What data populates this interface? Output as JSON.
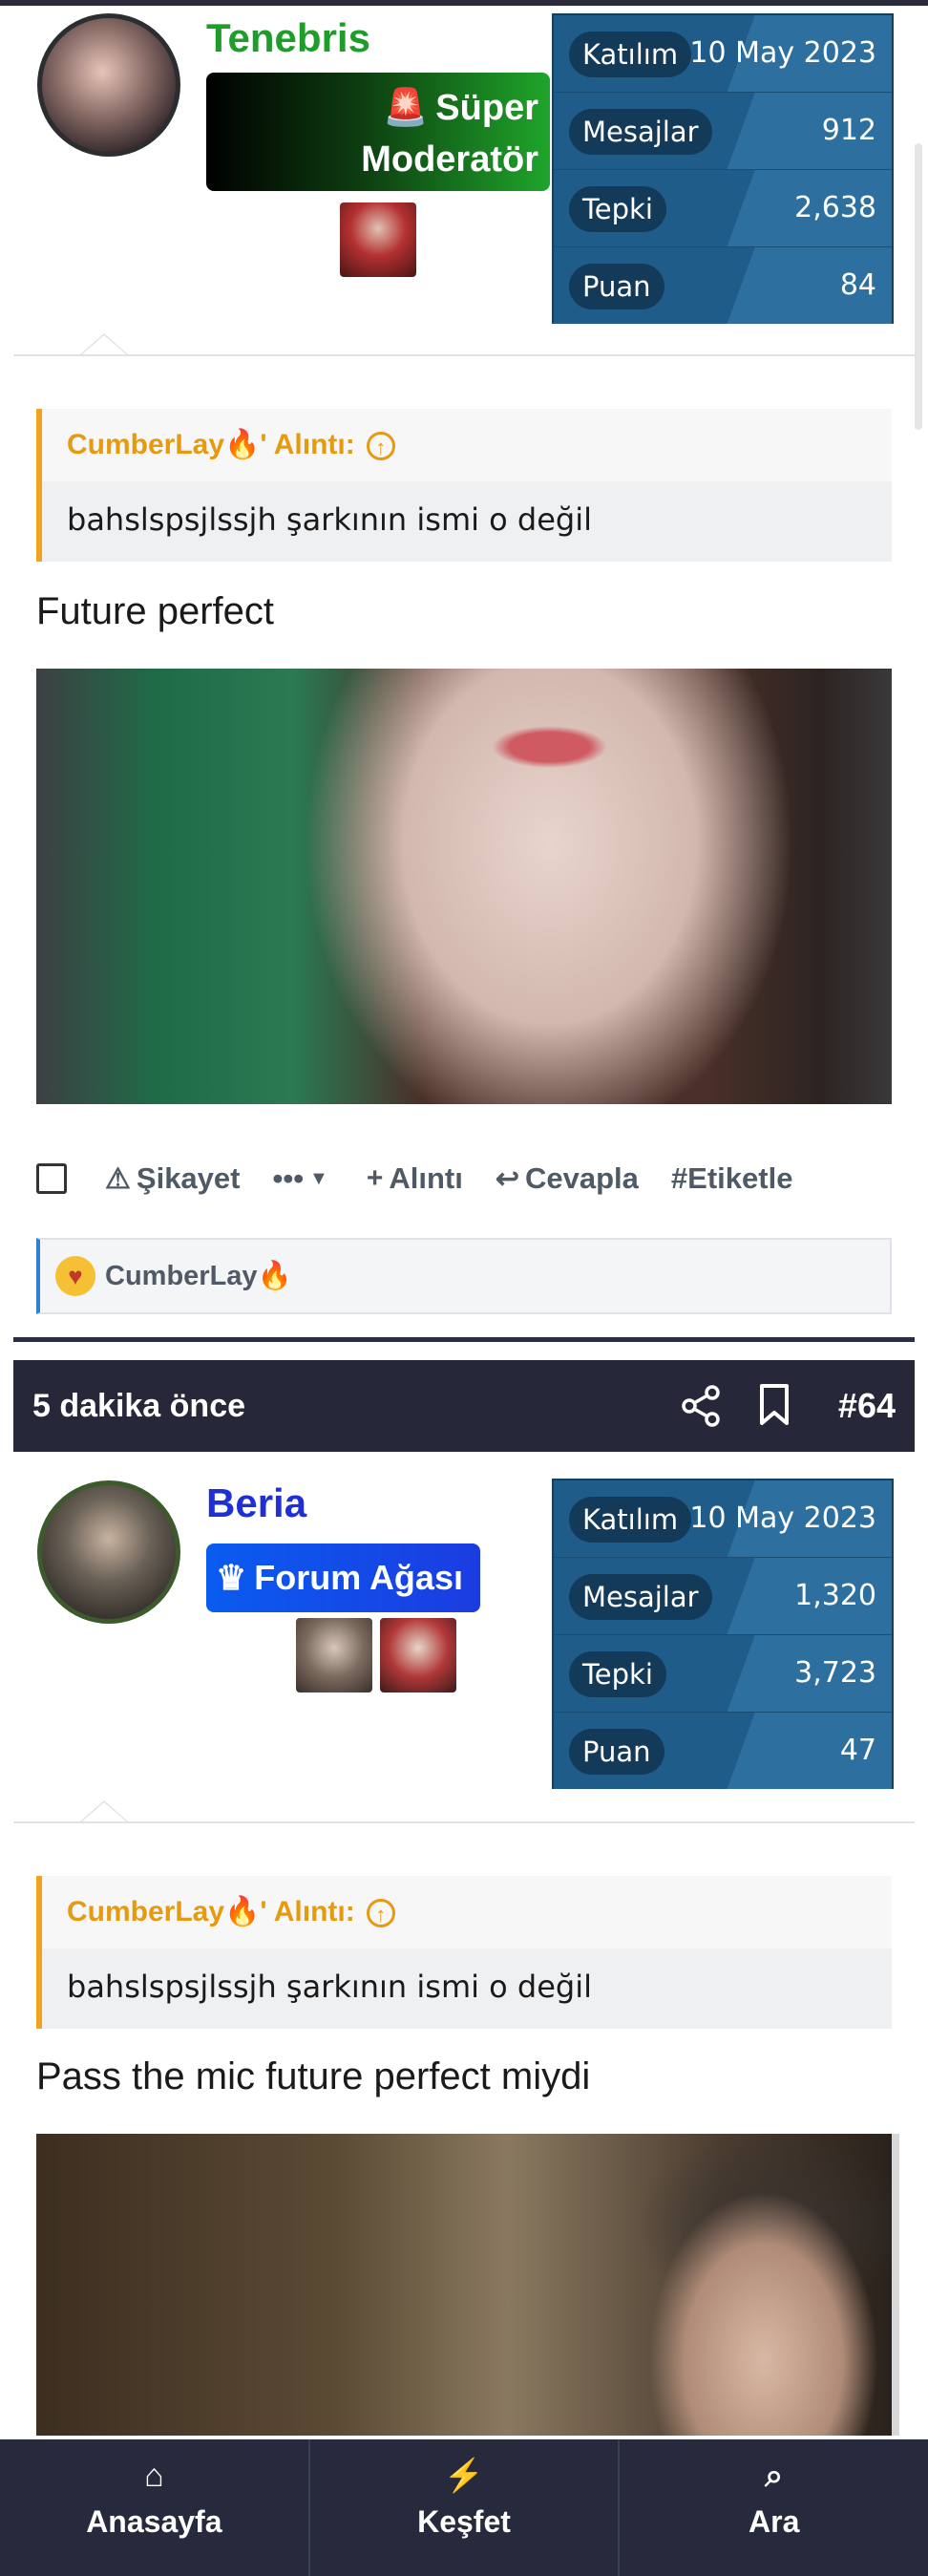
{
  "posts": [
    {
      "username": "Tenebris",
      "role": "Süper Moderatör",
      "stats": [
        {
          "label": "Katılım",
          "value": "10 May 2023"
        },
        {
          "label": "Mesajlar",
          "value": "912"
        },
        {
          "label": "Tepki",
          "value": "2,638"
        },
        {
          "label": "Puan",
          "value": "84"
        }
      ],
      "quote": {
        "author": "CumberLay🔥' Alıntı:",
        "text": "bahslspsjlssjh şarkının ismi o değil"
      },
      "text": "Future perfect",
      "actions": {
        "report": "Şikayet",
        "more": "•••",
        "quote": "Alıntı",
        "reply": "Cevapla",
        "tag": "#Etiketle"
      },
      "reaction_user": "CumberLay🔥"
    },
    {
      "time": "5 dakika önce",
      "number": "#64",
      "username": "Beria",
      "role": "Forum Ağası",
      "stats": [
        {
          "label": "Katılım",
          "value": "10 May 2023"
        },
        {
          "label": "Mesajlar",
          "value": "1,320"
        },
        {
          "label": "Tepki",
          "value": "3,723"
        },
        {
          "label": "Puan",
          "value": "47"
        }
      ],
      "quote": {
        "author": "CumberLay🔥' Alıntı:",
        "text": "bahslspsjlssjh şarkının ismi o değil"
      },
      "text": "Pass the mic future perfect miydi"
    }
  ],
  "bottom_nav": [
    {
      "label": "Anasayfa",
      "icon": "home-icon"
    },
    {
      "label": "Keşfet",
      "icon": "bolt-icon"
    },
    {
      "label": "Ara",
      "icon": "search-icon"
    }
  ],
  "colors": {
    "accent_green": "#1e9d2a",
    "accent_blue": "#1f2fd6",
    "quote_orange": "#e69a10",
    "stats_blue": "#1f5c8a",
    "nav_dark": "#262a3c"
  }
}
